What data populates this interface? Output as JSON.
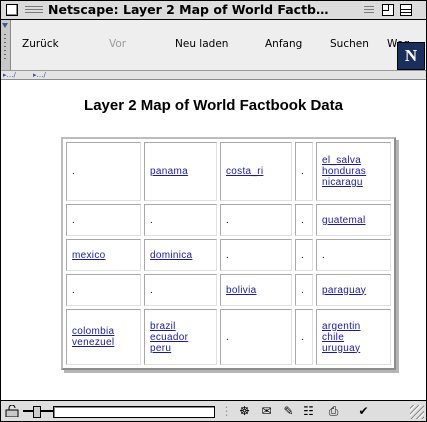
{
  "window": {
    "title": "Netscape: Layer 2 Map of World Factb…"
  },
  "toolbar": {
    "buttons": [
      {
        "label": "Zurück",
        "enabled": true
      },
      {
        "label": "Vor",
        "enabled": false
      },
      {
        "label": "Neu laden",
        "enabled": true
      },
      {
        "label": "Anfang",
        "enabled": true
      },
      {
        "label": "Suchen",
        "enabled": true
      },
      {
        "label": "Weg",
        "enabled": true
      }
    ],
    "logo_letter": "N"
  },
  "page": {
    "heading": "Layer 2 Map of World Factbook Data",
    "table": {
      "rows": [
        [
          {
            "text": ".",
            "links": []
          },
          {
            "text": "",
            "links": [
              "panama"
            ]
          },
          {
            "text": "",
            "links": [
              "costa_ri"
            ]
          },
          {
            "text": ".",
            "links": []
          },
          {
            "text": "",
            "links": [
              "el_salva",
              "honduras",
              "nicaragu"
            ]
          }
        ],
        [
          {
            "text": ".",
            "links": []
          },
          {
            "text": ".",
            "links": []
          },
          {
            "text": ".",
            "links": []
          },
          {
            "text": ".",
            "links": []
          },
          {
            "text": "",
            "links": [
              "guatemal"
            ]
          }
        ],
        [
          {
            "text": "",
            "links": [
              "mexico"
            ]
          },
          {
            "text": "",
            "links": [
              "dominica"
            ]
          },
          {
            "text": ".",
            "links": []
          },
          {
            "text": ".",
            "links": []
          },
          {
            "text": ".",
            "links": []
          }
        ],
        [
          {
            "text": ".",
            "links": []
          },
          {
            "text": ".",
            "links": []
          },
          {
            "text": "",
            "links": [
              "bolivia"
            ]
          },
          {
            "text": ".",
            "links": []
          },
          {
            "text": "",
            "links": [
              "paraguay"
            ]
          }
        ],
        [
          {
            "text": "",
            "links": [
              "colombia",
              "venezuel"
            ]
          },
          {
            "text": "",
            "links": [
              "brazil",
              "ecuador",
              "peru"
            ]
          },
          {
            "text": ".",
            "links": []
          },
          {
            "text": ".",
            "links": []
          },
          {
            "text": "",
            "links": [
              "argentin",
              "chile",
              "uruguay"
            ]
          }
        ]
      ]
    }
  },
  "colors": {
    "link": "#1a1aa6",
    "logo_bg": "#1b2f5e"
  }
}
